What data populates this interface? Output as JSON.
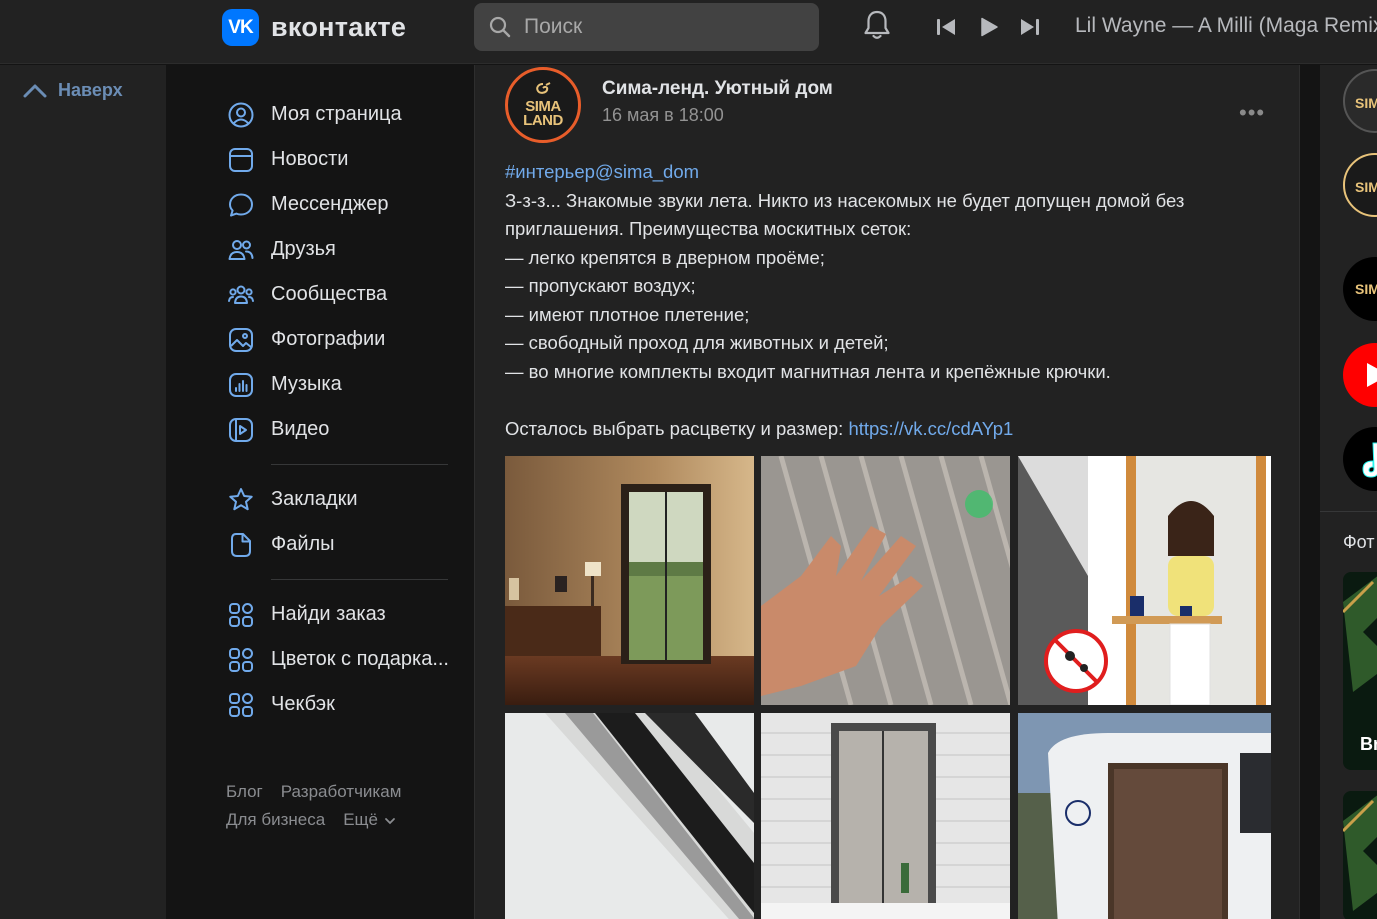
{
  "header": {
    "logo_mark": "VK",
    "logo_text": "вконтакте",
    "search_placeholder": "Поиск",
    "now_playing": "Lil Wayne — A Milli (Maga Remix)"
  },
  "left": {
    "up_label": "Наверх"
  },
  "sidebar": {
    "items": [
      {
        "label": "Моя страница",
        "icon": "user-circle-icon"
      },
      {
        "label": "Новости",
        "icon": "newsfeed-icon"
      },
      {
        "label": "Мессенджер",
        "icon": "message-icon"
      },
      {
        "label": "Друзья",
        "icon": "friends-icon"
      },
      {
        "label": "Сообщества",
        "icon": "communities-icon"
      },
      {
        "label": "Фотографии",
        "icon": "photos-icon"
      },
      {
        "label": "Музыка",
        "icon": "music-icon"
      },
      {
        "label": "Видео",
        "icon": "video-icon"
      }
    ],
    "items2": [
      {
        "label": "Закладки",
        "icon": "star-icon"
      },
      {
        "label": "Файлы",
        "icon": "file-icon"
      }
    ],
    "apps": [
      {
        "label": "Найди заказ",
        "icon": "app-grid-icon"
      },
      {
        "label": "Цветок с подарка...",
        "icon": "app-grid-icon"
      },
      {
        "label": "Чекбэк",
        "icon": "app-grid-icon"
      }
    ],
    "footer": {
      "blog": "Блог",
      "developers": "Разработчикам",
      "business": "Для бизнеса",
      "more": "Ещё"
    }
  },
  "post": {
    "avatar_line1": "SIMA",
    "avatar_line2": "LAND",
    "author": "Сима-ленд. Уютный дом",
    "date": "16 мая в 18:00",
    "hashtag": "#интерьер@sima_dom",
    "lines": [
      "З-з-з... Знакомые звуки лета. Никто из насекомых не будет допущен домой без",
      "приглашения. Преимущества москитных сеток:",
      "— легко крепятся в дверном проёме;",
      "— пропускают воздух;",
      "— имеют плотное плетение;",
      "— свободный проход для животных и детей;",
      "— во многие комплекты входит магнитная лента и крепёжные крючки."
    ],
    "cta_text": "Осталось выбрать расцветку и размер: ",
    "cta_link": "https://vk.cc/cdAYp1"
  },
  "right": {
    "section_title": "Фот",
    "card_text": "Br"
  },
  "colors": {
    "accent": "#0077ff",
    "link": "#71aaeb",
    "bg": "#141414",
    "card": "#222222"
  }
}
